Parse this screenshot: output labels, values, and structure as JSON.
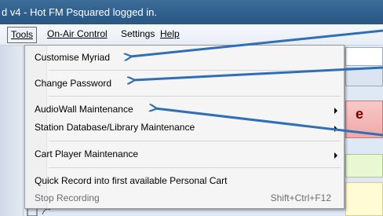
{
  "window": {
    "title": "d v4 - Hot FM Psquared logged in."
  },
  "menubar": {
    "items": [
      {
        "label": "Tools",
        "accel": "T"
      },
      {
        "label": "On-Air Control",
        "accel": "O"
      },
      {
        "label": "Settings"
      },
      {
        "label": "Help",
        "accel": "H"
      }
    ]
  },
  "tools_menu": {
    "items": [
      {
        "label": "Customise Myriad"
      },
      {
        "label": "Change Password"
      },
      {
        "label": "AudioWall Maintenance",
        "submenu": true
      },
      {
        "label": "Station Database/Library Maintenance",
        "submenu": true
      },
      {
        "label": "Cart Player Maintenance",
        "submenu": true
      },
      {
        "label": "Quick Record into first available Personal Cart"
      },
      {
        "label": "Stop Recording",
        "shortcut": "Shift+Ctrl+F12",
        "disabled": true
      }
    ]
  },
  "background": {
    "partial_text": "e"
  },
  "colors": {
    "titlebar": "#2f5f8d",
    "annotation_arrow": "#2f6fb5",
    "menu_bg": "#f5f5f5"
  }
}
